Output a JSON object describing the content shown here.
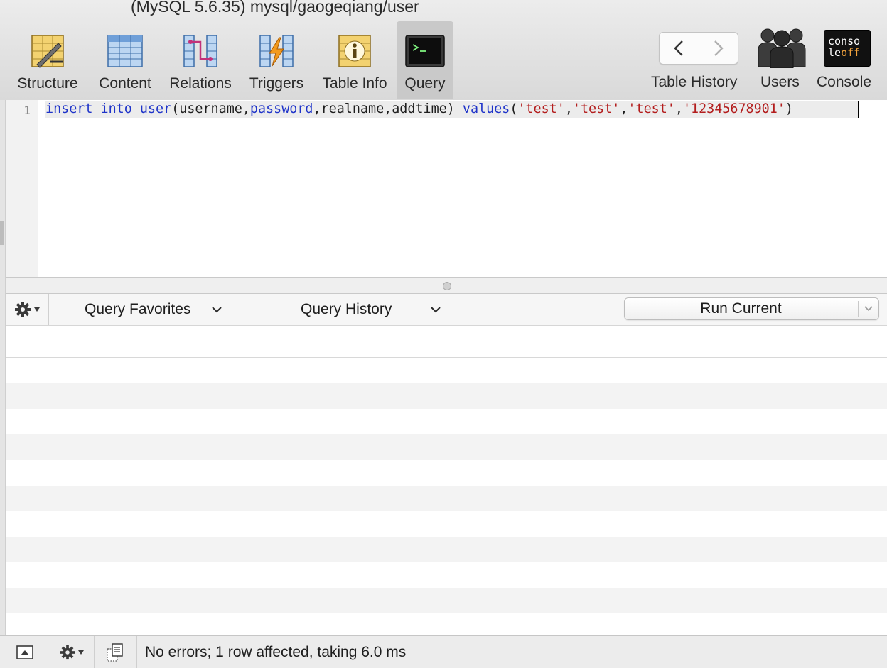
{
  "window": {
    "title": "(MySQL 5.6.35) mysql/gaogeqiang/user"
  },
  "toolbar": {
    "tabs": [
      {
        "label": "Structure",
        "icon": "structure-icon"
      },
      {
        "label": "Content",
        "icon": "content-icon"
      },
      {
        "label": "Relations",
        "icon": "relations-icon"
      },
      {
        "label": "Triggers",
        "icon": "triggers-icon"
      },
      {
        "label": "Table Info",
        "icon": "table-info-icon"
      },
      {
        "label": "Query",
        "icon": "query-terminal-icon",
        "active": true
      }
    ],
    "right": [
      {
        "label": "Table History",
        "icon": "history-nav-icon"
      },
      {
        "label": "Users",
        "icon": "users-icon"
      },
      {
        "label": "Console",
        "icon": "console-icon",
        "badge_top": "conso",
        "badge_bottom_a": "le",
        "badge_bottom_b": "off"
      }
    ]
  },
  "editor": {
    "line_number": "1",
    "tokens": {
      "t1": "insert",
      "t2": " ",
      "t3": "into",
      "t4": " ",
      "t5": "user",
      "t6": "(username,",
      "t7": "password",
      "t8": ",realname,addtime) ",
      "t9": "values",
      "t10": "(",
      "t11": "'test'",
      "t12": ",",
      "t13": "'test'",
      "t14": ",",
      "t15": "'test'",
      "t16": ",",
      "t17": "'12345678901'",
      "t18": ")"
    }
  },
  "query_bar": {
    "favorites_label": "Query Favorites",
    "history_label": "Query History",
    "run_label": "Run Current"
  },
  "status_bar": {
    "message": "No errors; 1 row affected, taking 6.0 ms"
  },
  "colors": {
    "keyword": "#1f34c9",
    "string": "#b31d1d",
    "toolbar_bg": "#dedede",
    "active_tab_bg": "#c9c9c9"
  }
}
